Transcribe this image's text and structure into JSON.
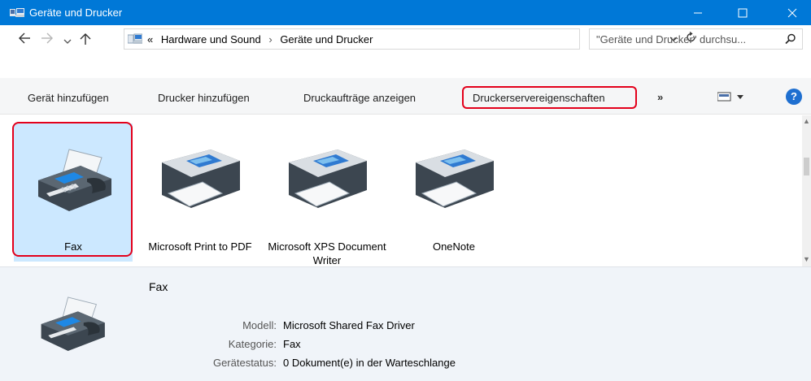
{
  "window": {
    "title": "Geräte und Drucker",
    "minimize_icon": "minimize-icon",
    "maximize_icon": "maximize-icon",
    "close_icon": "close-icon"
  },
  "address": {
    "back_icon": "back-arrow-icon",
    "forward_icon": "forward-arrow-icon",
    "recent_icon": "chevron-down-icon",
    "up_icon": "up-arrow-icon",
    "overflow": "«",
    "crumbs": [
      "Hardware und Sound",
      "Geräte und Drucker"
    ],
    "separator": "›",
    "search_placeholder": "\"Geräte und Drucker\" durchsu..."
  },
  "commands": {
    "add_device": "Gerät hinzufügen",
    "add_printer": "Drucker hinzufügen",
    "print_jobs": "Druckaufträge anzeigen",
    "server_props": "Druckerservereigenschaften",
    "more": "»",
    "help": "?"
  },
  "devices": [
    {
      "label": "Fax",
      "icon": "fax-icon",
      "selected": true
    },
    {
      "label": "Microsoft Print to PDF",
      "icon": "printer-icon",
      "selected": false
    },
    {
      "label": "Microsoft XPS Document Writer",
      "icon": "printer-icon",
      "selected": false
    },
    {
      "label": "OneNote",
      "icon": "printer-icon",
      "selected": false
    }
  ],
  "details": {
    "name": "Fax",
    "model_label": "Modell:",
    "model_value": "Microsoft Shared Fax Driver",
    "category_label": "Kategorie:",
    "category_value": "Fax",
    "status_label": "Gerätestatus:",
    "status_value": "0 Dokument(e) in der Warteschlange"
  },
  "colors": {
    "titlebar": "#0078d7",
    "selection": "#cce8ff",
    "highlight": "#e3001b",
    "details_bg": "#f0f4f9"
  }
}
